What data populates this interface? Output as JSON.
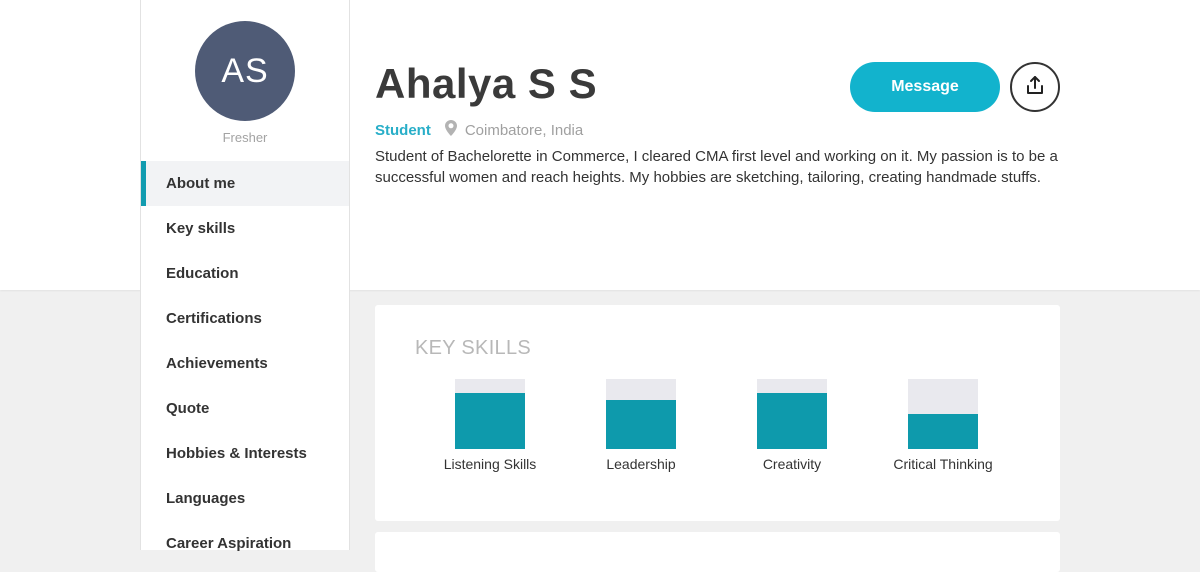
{
  "profile": {
    "initials": "AS",
    "role": "Fresher",
    "name": "Ahalya S S",
    "tag": "Student",
    "location": "Coimbatore, India",
    "bio": "Student of Bachelorette in Commerce, I cleared CMA first level and working on it. My passion is to be a successful women and reach heights. My hobbies are sketching, tailoring, creating handmade stuffs."
  },
  "actions": {
    "message_label": "Message",
    "share_icon": "share-upload-icon"
  },
  "sidebar": {
    "items": [
      {
        "label": "About me",
        "active": true
      },
      {
        "label": "Key skills"
      },
      {
        "label": "Education"
      },
      {
        "label": "Certifications"
      },
      {
        "label": "Achievements"
      },
      {
        "label": "Quote"
      },
      {
        "label": "Hobbies & Interests"
      },
      {
        "label": "Languages"
      },
      {
        "label": "Career Aspiration"
      }
    ]
  },
  "key_skills": {
    "title": "KEY SKILLS",
    "skills": [
      {
        "label": "Listening Skills",
        "level": 0.8
      },
      {
        "label": "Leadership",
        "level": 0.7
      },
      {
        "label": "Creativity",
        "level": 0.8
      },
      {
        "label": "Critical Thinking",
        "level": 0.5
      }
    ]
  },
  "colors": {
    "accent": "#12b3cd",
    "bar": "#0e9aac",
    "avatar": "#4f5b76"
  }
}
